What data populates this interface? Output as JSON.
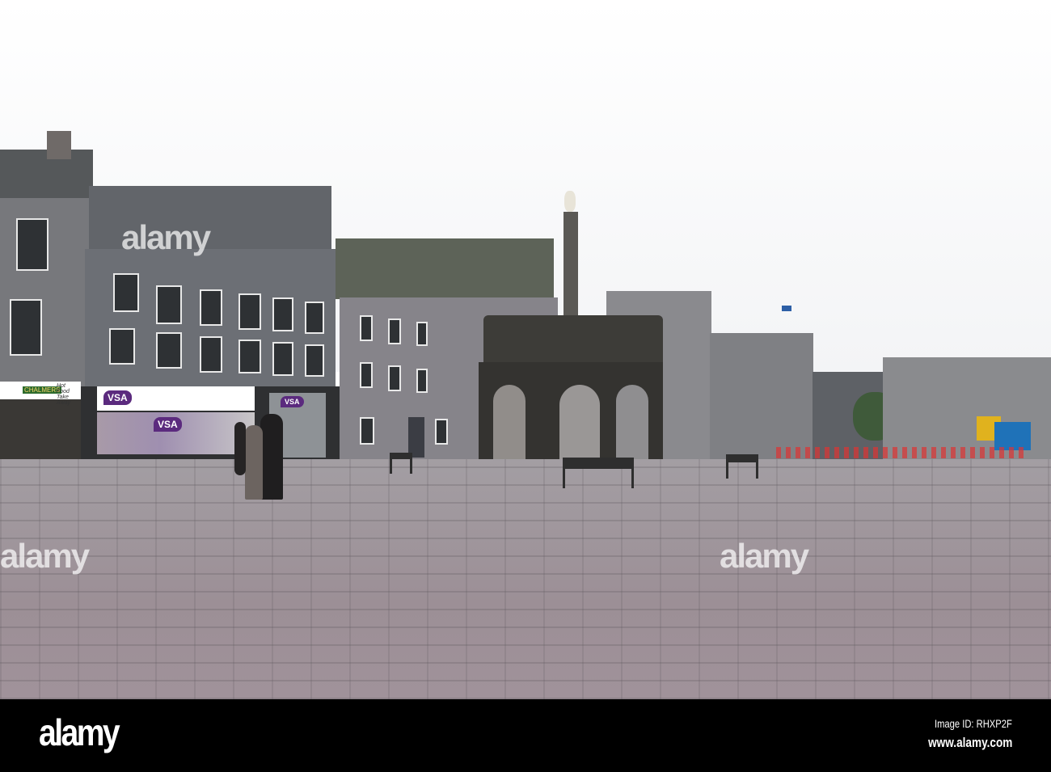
{
  "photo": {
    "watermarks": [
      "alamy",
      "alamy",
      "alamy"
    ],
    "shop_signs": {
      "vsa_main": "VSA",
      "vsa_window": "VSA",
      "vsa_side": "VSA",
      "chalmers": "CHALMERS",
      "hot_food": "Hot Food Take Away"
    }
  },
  "footer": {
    "logo": "alamy",
    "image_id": "Image ID: RHXP2F",
    "url": "www.alamy.com"
  }
}
